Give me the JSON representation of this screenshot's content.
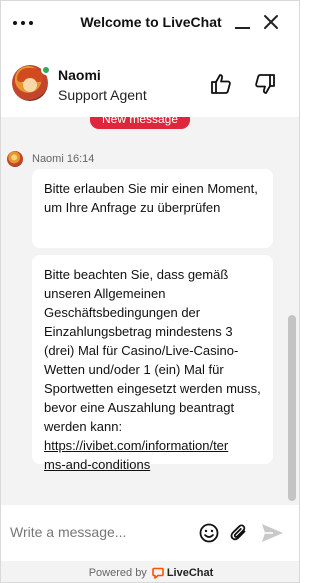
{
  "window": {
    "title": "Welcome to LiveChat"
  },
  "agent": {
    "name": "Naomi",
    "role": "Support Agent",
    "status": "online"
  },
  "chat": {
    "new_message_label": "New message",
    "messages": [
      {
        "author": "Naomi",
        "time": "16:14",
        "meta": "Naomi 16:14",
        "text": "Bitte erlauben Sie mir einen Moment, um Ihre Anfrage zu überprüfen"
      },
      {
        "text": "Bitte beachten Sie, dass gemäß unseren Allgemeinen Geschäftsbedingungen der Einzahlungsbetrag mindestens 3 (drei) Mal für Casino/Live-Casino-Wetten und/oder 1 (ein) Mal für Sportwetten eingesetzt werden muss, bevor eine Auszahlung beantragt werden kann:",
        "link_line_1": "https://ivibet.com/information/ter",
        "link_line_2": "ms-and-conditions"
      }
    ]
  },
  "composer": {
    "placeholder": "Write a message...",
    "value": ""
  },
  "footer": {
    "powered_by": "Powered by",
    "brand": "LiveChat"
  },
  "colors": {
    "accent_red": "#e0263c",
    "online_green": "#2faa55",
    "chat_background": "#f3f3f3",
    "brand_orange": "#ff5100"
  },
  "icons": {
    "menu": "dots-horizontal-icon",
    "minimize": "minimize-icon",
    "close": "close-icon",
    "rate_good": "thumbs-up-icon",
    "rate_bad": "thumbs-down-icon",
    "emoji": "emoji-icon",
    "attach": "paperclip-icon",
    "send": "send-icon",
    "brand": "livechat-logo-icon"
  }
}
